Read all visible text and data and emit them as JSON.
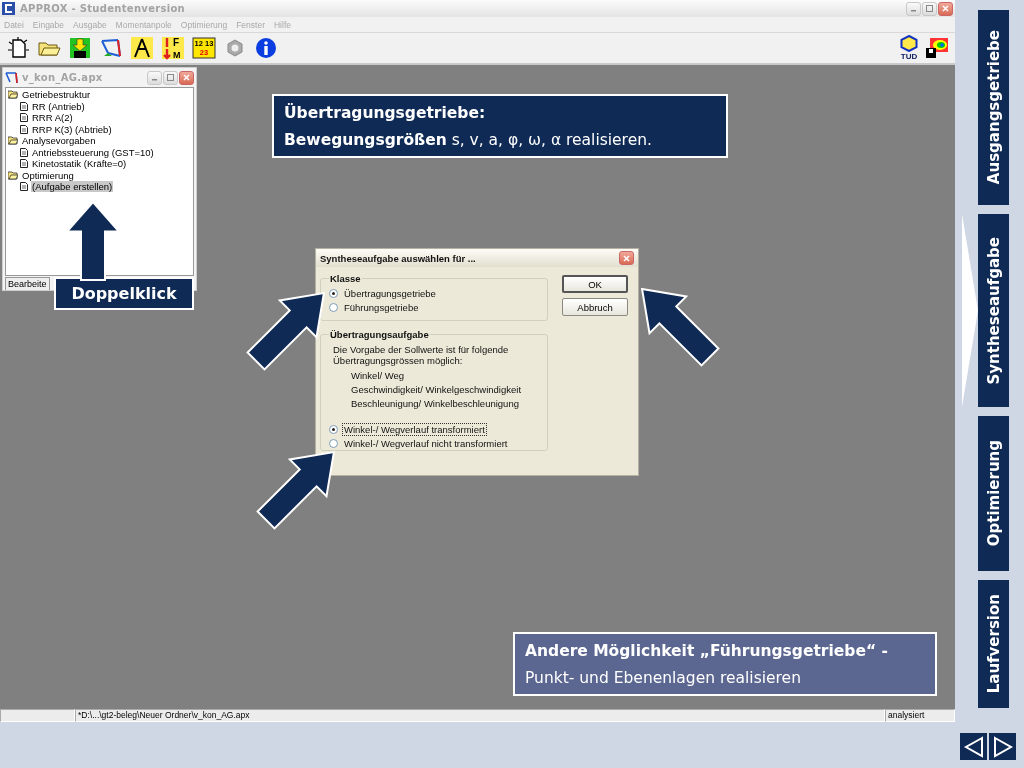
{
  "app": {
    "title": "APPROX - Studentenversion",
    "menu": [
      {
        "label": "Datei",
        "disabled": true
      },
      {
        "label": "Eingabe",
        "disabled": true
      },
      {
        "label": "Ausgabe",
        "disabled": true
      },
      {
        "label": "Momentanpole",
        "disabled": true
      },
      {
        "label": "Optimierung",
        "disabled": true
      },
      {
        "label": "Fenster",
        "disabled": true
      },
      {
        "label": "Hilfe",
        "disabled": true
      }
    ],
    "toolbar_left": [
      {
        "kind": "new"
      },
      {
        "kind": "open"
      },
      {
        "kind": "save"
      },
      {
        "kind": "linkage"
      },
      {
        "kind": "compass"
      },
      {
        "kind": "force",
        "letters": [
          "F",
          "M"
        ]
      },
      {
        "kind": "numbers",
        "lines": [
          "12 13",
          "23"
        ]
      },
      {
        "kind": "gear"
      },
      {
        "kind": "info"
      }
    ],
    "toolbar_right": [
      {
        "kind": "optimus",
        "text": "TUD"
      },
      {
        "kind": "chart"
      }
    ],
    "child_window": {
      "title": "v_kon_AG.apx",
      "tree": [
        {
          "label": "Getriebestruktur",
          "selected": false,
          "children": [
            {
              "label": "RR (Antrieb)",
              "selected": false
            },
            {
              "label": "RRR A(2)",
              "selected": false
            },
            {
              "label": "RRP K(3) (Abtrieb)",
              "selected": false
            }
          ]
        },
        {
          "label": "Analysevorgaben",
          "selected": false,
          "children": [
            {
              "label": "Antriebssteuerung (GST=10)",
              "selected": false
            },
            {
              "label": "Kinetostatik (Kräfte=0)",
              "selected": false
            }
          ]
        },
        {
          "label": "Optimierung",
          "selected": false,
          "children": [
            {
              "label": "(Aufgabe erstellen)",
              "selected": true
            }
          ]
        }
      ],
      "tab": "Bearbeite"
    },
    "info_box": {
      "heading": "Übertragungsgetriebe:",
      "text": "**Bewegungsgrößen** s, v, a,  φ, ω, α realisieren."
    },
    "double_click_label": "Doppelklick",
    "dialog": {
      "title": "Syntheseaufgabe auswählen für ...",
      "class_group": {
        "title": "Klasse",
        "options": [
          {
            "label": "Übertragungsgetriebe",
            "selected": true
          },
          {
            "label": "Führungsgetriebe",
            "selected": false
          }
        ]
      },
      "buttons": [
        {
          "label": "OK",
          "default": true
        },
        {
          "label": "Abbruch",
          "default": false
        }
      ],
      "task_group": {
        "title": "Übertragungsaufgabe",
        "intro": "Die Vorgabe der Sollwerte ist für folgende Übertragungsgrössen möglich:",
        "items": [
          "Winkel/ Weg",
          "Geschwindigkeit/ Winkelgeschwindigkeit",
          "Beschleunigung/ Winkelbeschleunigung"
        ],
        "options": [
          {
            "label": "Winkel-/ Wegverlauf transformiert",
            "selected": true
          },
          {
            "label": "Winkel-/ Wegverlauf nicht transformiert",
            "selected": false
          }
        ]
      }
    },
    "note_box": {
      "heading": "Andere Möglichkeit „Führungsgetriebe“ -",
      "text": "Punkt- und Ebenenlagen realisieren"
    },
    "status_bar": {
      "path": "*D:\\...\\gt2-beleg\\Neuer Ordner\\v_kon_AG.apx",
      "state": "analysiert"
    }
  },
  "slide_tabs": [
    {
      "label": "Ausgangsgetriebe",
      "selected": false
    },
    {
      "label": "Syntheseaufgabe",
      "selected": true
    },
    {
      "label": "Optimierung",
      "selected": false
    },
    {
      "label": "Laufversion",
      "selected": false
    }
  ]
}
